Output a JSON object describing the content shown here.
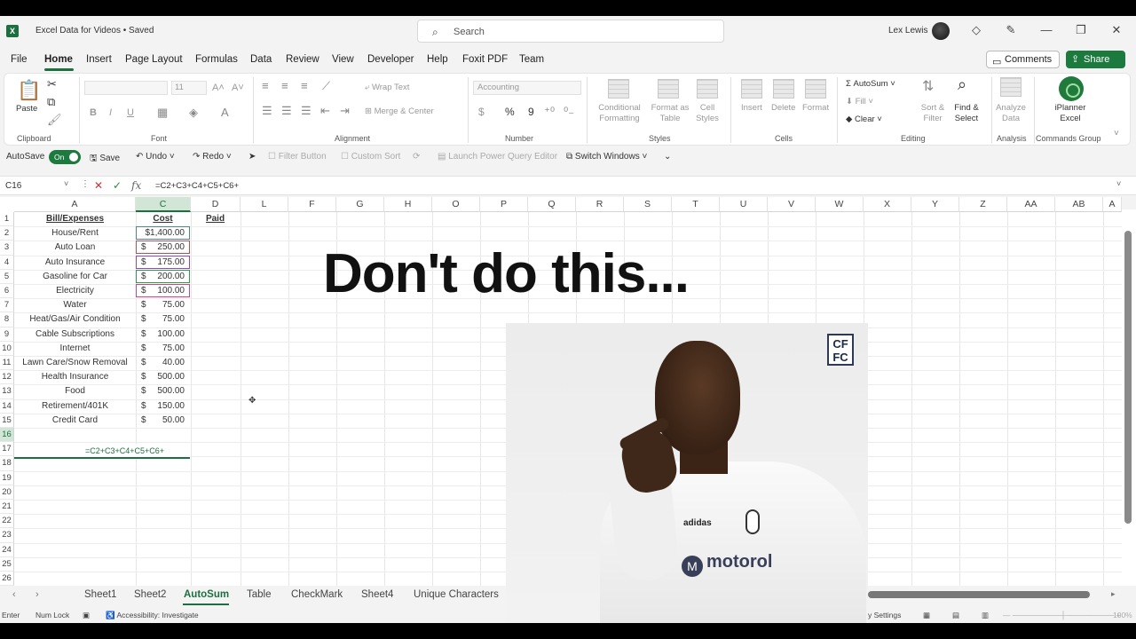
{
  "window": {
    "title": "Excel Data for Videos • Saved",
    "search_placeholder": "Search",
    "user_name": "Lex Lewis"
  },
  "menu": [
    "File",
    "Home",
    "Insert",
    "Page Layout",
    "Formulas",
    "Data",
    "Review",
    "View",
    "Developer",
    "Help",
    "Foxit PDF",
    "Team"
  ],
  "menu_active": "Home",
  "actions": {
    "comments": "Comments",
    "share": "Share"
  },
  "ribbon": {
    "clipboard": {
      "label": "Clipboard",
      "paste": "Paste"
    },
    "font": {
      "label": "Font",
      "size": "11",
      "bold": "B",
      "italic": "I",
      "underline": "U"
    },
    "alignment": {
      "label": "Alignment",
      "wrap": "Wrap Text",
      "merge": "Merge & Center"
    },
    "number": {
      "label": "Number",
      "format": "Accounting",
      "currency": "$",
      "percent": "%",
      "comma": "9"
    },
    "styles": {
      "label": "Styles",
      "conditional": "Conditional Formatting",
      "format_table": "Format as Table",
      "cell_styles": "Cell Styles"
    },
    "cells": {
      "label": "Cells",
      "insert": "Insert",
      "delete": "Delete",
      "format": "Format"
    },
    "editing": {
      "label": "Editing",
      "autosum": "AutoSum",
      "fill": "Fill",
      "clear": "Clear",
      "sort": "Sort & Filter",
      "find": "Find & Select"
    },
    "analysis": {
      "label": "Analysis",
      "analyze": "Analyze Data"
    },
    "commands": {
      "label": "Commands Group",
      "iplanner": "iPlanner Excel"
    }
  },
  "qat": {
    "autosave": "AutoSave",
    "toggle": "On",
    "save": "Save",
    "undo": "Undo",
    "redo": "Redo",
    "filter": "Filter Button",
    "custom_sort": "Custom Sort",
    "power_query": "Launch Power Query Editor",
    "switch_windows": "Switch Windows"
  },
  "formula_bar": {
    "name_box": "C16",
    "formula": "=C2+C3+C4+C5+C6+"
  },
  "columns": [
    "A",
    "C",
    "D",
    "L",
    "F",
    "G",
    "H",
    "O",
    "P",
    "Q",
    "R",
    "S",
    "T",
    "U",
    "V",
    "W",
    "X",
    "Y",
    "Z",
    "AA",
    "AB",
    "A"
  ],
  "rows": [
    "1",
    "2",
    "3",
    "4",
    "5",
    "6",
    "7",
    "8",
    "9",
    "10",
    "11",
    "12",
    "13",
    "14",
    "15",
    "16",
    "17",
    "18",
    "19",
    "20",
    "21",
    "22",
    "23",
    "24",
    "25",
    "26"
  ],
  "sheet": {
    "headers": {
      "bill": "Bill/Expenses",
      "cost": "Cost",
      "paid": "Paid"
    },
    "expenses": [
      {
        "name": "House/Rent",
        "dollar": "",
        "amount": "$1,400.00"
      },
      {
        "name": "Auto Loan",
        "dollar": "$",
        "amount": "250.00"
      },
      {
        "name": "Auto Insurance",
        "dollar": "$",
        "amount": "175.00"
      },
      {
        "name": "Gasoline for Car",
        "dollar": "$",
        "amount": "200.00"
      },
      {
        "name": "Electricity",
        "dollar": "$",
        "amount": "100.00"
      },
      {
        "name": "Water",
        "dollar": "$",
        "amount": "75.00"
      },
      {
        "name": "Heat/Gas/Air Condition",
        "dollar": "$",
        "amount": "75.00"
      },
      {
        "name": "Cable Subscriptions",
        "dollar": "$",
        "amount": "100.00"
      },
      {
        "name": "Internet",
        "dollar": "$",
        "amount": "75.00"
      },
      {
        "name": "Lawn Care/Snow Removal",
        "dollar": "$",
        "amount": "40.00"
      },
      {
        "name": "Health Insurance",
        "dollar": "$",
        "amount": "500.00"
      },
      {
        "name": "Food",
        "dollar": "$",
        "amount": "500.00"
      },
      {
        "name": "Retirement/401K",
        "dollar": "$",
        "amount": "150.00"
      },
      {
        "name": "Credit Card",
        "dollar": "$",
        "amount": "50.00"
      }
    ],
    "edit_formula": "=C2+C3+C4+C5+C6+",
    "ref_colors": [
      "#4a7cc9",
      "#c64a4a",
      "#8a4ab8",
      "#2f9a4a",
      "#c04a8a"
    ]
  },
  "overlay": {
    "caption": "Don't do this...",
    "logo_text": "CF FC",
    "sponsor": "motorol",
    "brand": "adidas"
  },
  "sheet_tabs": [
    "Sheet1",
    "Sheet2",
    "AutoSum",
    "Table",
    "CheckMark",
    "Sheet4",
    "Unique Characters"
  ],
  "sheet_tab_active": "AutoSum",
  "status": {
    "mode": "Enter",
    "numlock": "Num Lock",
    "accessibility": "Accessibility: Investigate",
    "settings": "y Settings",
    "zoom": "100%"
  }
}
